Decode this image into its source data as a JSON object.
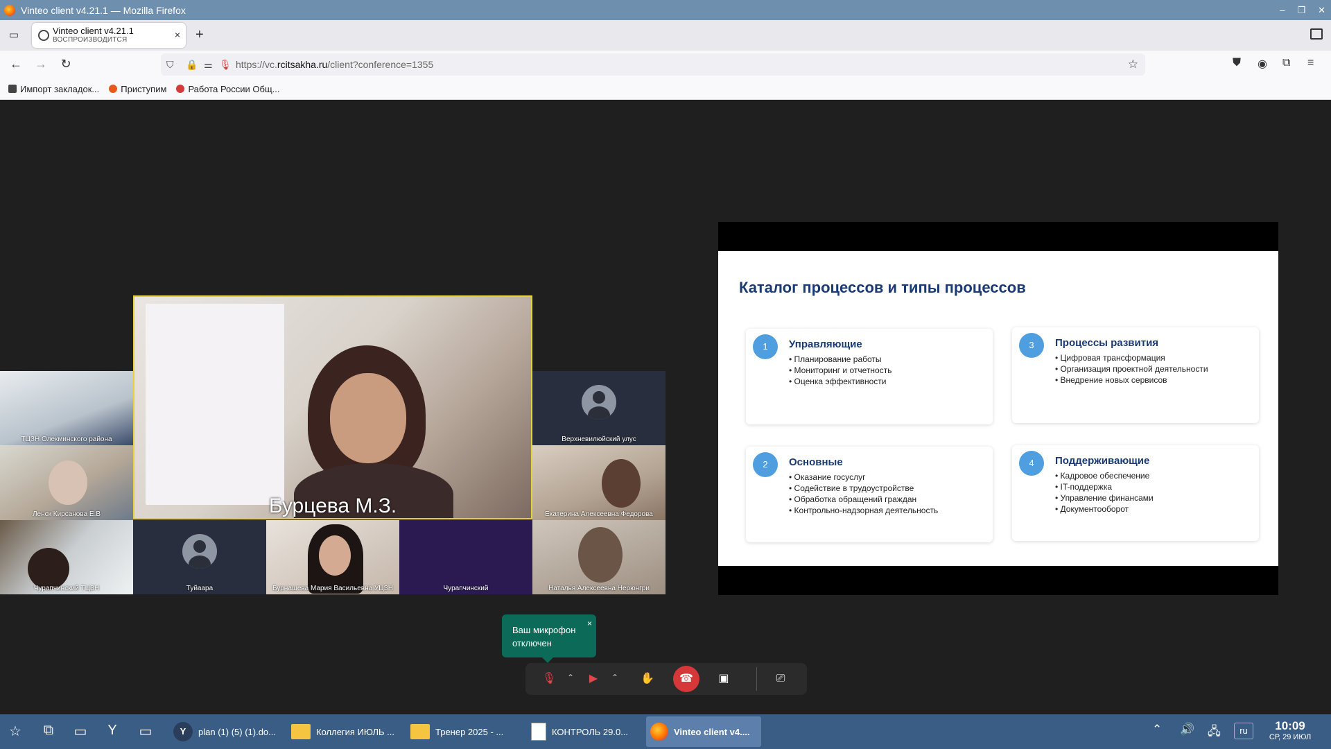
{
  "window": {
    "title": "Vinteo client v4.21.1 — Mozilla Firefox",
    "controls": [
      "–",
      "❐",
      "✕"
    ]
  },
  "tab": {
    "title": "Vinteo client v4.21.1",
    "status": "ВОСПРОИЗВОДИТСЯ",
    "close": "×",
    "new": "+"
  },
  "nav": {
    "url_prefix": "https://vc.",
    "url_domain": "rcitsakha.ru",
    "url_rest": "/client?conference=1355"
  },
  "bookmarks": [
    {
      "label": "Импорт закладок...",
      "color": "#444444"
    },
    {
      "label": "Приступим",
      "color": "#e8581c"
    },
    {
      "label": "Работа России Общ...",
      "color": "#d43b3b"
    }
  ],
  "conference": {
    "speaker": "Бурцева М.З.",
    "participants": [
      "ТЦЗН Олекминского района",
      "Ленск Кирсанова Е.В",
      "Чурапчинский ТЦЗН",
      "Туйаара",
      "Бурнашева Мария Васильевна УЦЗН",
      "Чурапчинский",
      "Верхневилюйский улус",
      "Екатерина Алексеевна Федорова",
      "Наталья Алексеевна Нерюнгри"
    ]
  },
  "slide": {
    "title": "Каталог процессов и типы процессов",
    "cards": [
      {
        "num": "1",
        "title": "Управляющие",
        "items": [
          "Планирование работы",
          "Мониторинг и отчетность",
          "Оценка эффективности"
        ]
      },
      {
        "num": "3",
        "title": "Процессы развития",
        "items": [
          "Цифровая трансформация",
          "Организация проектной деятельности",
          "Внедрение новых сервисов"
        ]
      },
      {
        "num": "2",
        "title": "Основные",
        "items": [
          "Оказание госуслуг",
          "Содействие в трудоустройстве",
          "Обработка обращений граждан",
          "Контрольно-надзорная деятельность"
        ]
      },
      {
        "num": "4",
        "title": "Поддерживающие",
        "items": [
          "Кадровое обеспечение",
          "IT-поддержка",
          "Управление финансами",
          "Документооборот"
        ]
      }
    ]
  },
  "toast": {
    "text_line1": "Ваш микрофон",
    "text_line2": "отключен",
    "close": "×"
  },
  "taskbar": {
    "items": [
      {
        "label": "plan (1) (5) (1).do...",
        "icon": "yandex-icon"
      },
      {
        "label": "Коллегия ИЮЛЬ ...",
        "icon": "folder-icon"
      },
      {
        "label": "Тренер 2025 - ...",
        "icon": "folder-icon"
      },
      {
        "label": "КОНТРОЛЬ 29.0...",
        "icon": "spreadsheet-icon"
      },
      {
        "label": "Vinteo client v4....",
        "icon": "firefox-icon"
      }
    ],
    "lang": "ru",
    "time": "10:09",
    "date": "СР, 29 ИЮЛ"
  },
  "colors": {
    "titlebar": "#6f8fae",
    "taskbar": "#3a5d86",
    "speaker_border": "#e8d23a",
    "toast": "#0c6b58",
    "hangup": "#d6383a",
    "slide_title": "#1a3a73",
    "card_num": "#4f9fe0"
  }
}
